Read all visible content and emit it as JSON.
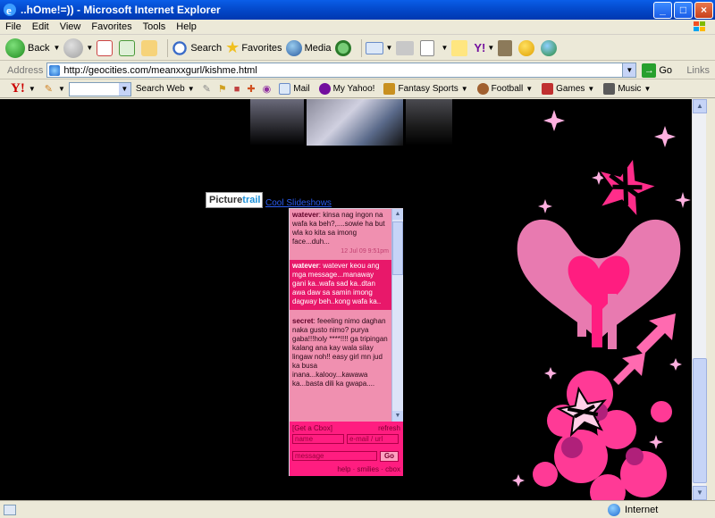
{
  "window": {
    "title": "..hOme!=))  - Microsoft Internet Explorer"
  },
  "menu": [
    "File",
    "Edit",
    "View",
    "Favorites",
    "Tools",
    "Help"
  ],
  "toolbar": {
    "back": "Back",
    "search": "Search",
    "favorites": "Favorites",
    "media": "Media"
  },
  "address": {
    "label": "Address",
    "url": "http://geocities.com/meanxxgurl/kishme.html",
    "go": "Go",
    "links": "Links"
  },
  "yahoo": {
    "logo": "Y!",
    "search_web": "Search Web",
    "items": [
      "Mail",
      "My Yahoo!",
      "Fantasy Sports",
      "Football",
      "Games",
      "Music"
    ]
  },
  "page": {
    "picturetrail_a": "Picture",
    "picturetrail_b": "trail",
    "cool_slideshows": "Cool Slideshows"
  },
  "cbox": {
    "messages": [
      {
        "name": "watever",
        "text": ": kinsa nag ingon na wafa ka beh?,....sowie ha but wla ko kita sa imong face...duh...",
        "stamp": "12 Jul 09 9:51pm",
        "alt": false
      },
      {
        "name": "watever",
        "text": ": watever keou ang mga message...manaway gani ka..wafa sad ka..dtan awa daw sa samin imong dagway beh..kong wafa ka..",
        "stamp": "",
        "alt": true
      },
      {
        "name": "secret",
        "text": ": feeeling nimo daghan naka gusto nimo? purya gaba!!!holy ****!!!! ga tripingan kalang ana kay wala silay lingaw noh!! easy girl mn jud ka busa inana...kalooy...kawawa ka...basta dili ka gwapa....",
        "stamp": "",
        "alt": false
      }
    ],
    "get_cbox": "[Get a Cbox]",
    "refresh": "refresh",
    "name_placeholder": "name",
    "email_placeholder": "e-mail / url",
    "message_placeholder": "message",
    "go": "Go",
    "footer": "help · smilies · cbox"
  },
  "status": {
    "zone": "Internet"
  },
  "colors": {
    "titlebar": "#0a5ee8",
    "page_bg": "#000000",
    "cbox_pink": "#ff1d80",
    "cbox_light": "#f090b0"
  }
}
